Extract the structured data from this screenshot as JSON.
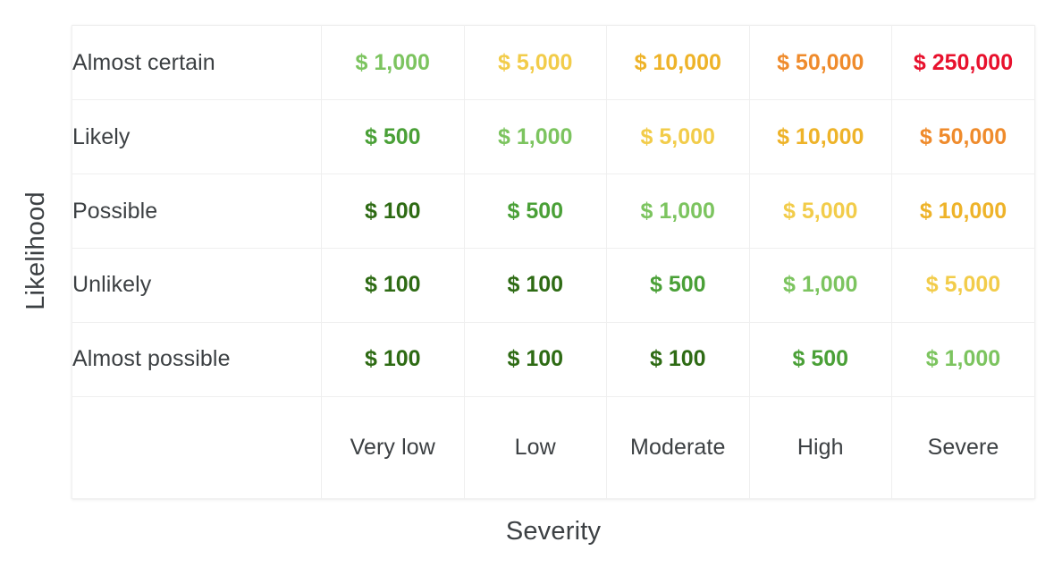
{
  "axes": {
    "y_label": "Likelihood",
    "x_label": "Severity"
  },
  "chart_data": {
    "type": "heatmap",
    "title": "",
    "xlabel": "Severity",
    "ylabel": "Likelihood",
    "x_categories": [
      "Very low",
      "Low",
      "Moderate",
      "High",
      "Severe"
    ],
    "y_categories": [
      "Almost certain",
      "Likely",
      "Possible",
      "Unlikely",
      "Almost possible"
    ],
    "legend": [],
    "grid": true,
    "cell_text_colors": {
      "$ 100": "#2e6b14",
      "$ 500": "#4aa037",
      "$ 1,000": "#7cc45f",
      "$ 5,000": "#f2cc4a",
      "$ 10,000": "#eeb329",
      "$ 50,000": "#ef8b2c",
      "$ 250,000": "#e8112d"
    },
    "rows": [
      {
        "label": "Almost certain",
        "cells": [
          {
            "text": "$ 1,000",
            "value": 1000,
            "color": "#7cc45f"
          },
          {
            "text": "$ 5,000",
            "value": 5000,
            "color": "#f2cc4a"
          },
          {
            "text": "$ 10,000",
            "value": 10000,
            "color": "#eeb329"
          },
          {
            "text": "$ 50,000",
            "value": 50000,
            "color": "#ef8b2c"
          },
          {
            "text": "$ 250,000",
            "value": 250000,
            "color": "#e8112d"
          }
        ]
      },
      {
        "label": "Likely",
        "cells": [
          {
            "text": "$ 500",
            "value": 500,
            "color": "#4aa037"
          },
          {
            "text": "$ 1,000",
            "value": 1000,
            "color": "#7cc45f"
          },
          {
            "text": "$ 5,000",
            "value": 5000,
            "color": "#f2cc4a"
          },
          {
            "text": "$ 10,000",
            "value": 10000,
            "color": "#eeb329"
          },
          {
            "text": "$ 50,000",
            "value": 50000,
            "color": "#ef8b2c"
          }
        ]
      },
      {
        "label": "Possible",
        "cells": [
          {
            "text": "$ 100",
            "value": 100,
            "color": "#2e6b14"
          },
          {
            "text": "$ 500",
            "value": 500,
            "color": "#4aa037"
          },
          {
            "text": "$ 1,000",
            "value": 1000,
            "color": "#7cc45f"
          },
          {
            "text": "$ 5,000",
            "value": 5000,
            "color": "#f2cc4a"
          },
          {
            "text": "$ 10,000",
            "value": 10000,
            "color": "#eeb329"
          }
        ]
      },
      {
        "label": "Unlikely",
        "cells": [
          {
            "text": "$ 100",
            "value": 100,
            "color": "#2e6b14"
          },
          {
            "text": "$ 100",
            "value": 100,
            "color": "#2e6b14"
          },
          {
            "text": "$ 500",
            "value": 500,
            "color": "#4aa037"
          },
          {
            "text": "$ 1,000",
            "value": 1000,
            "color": "#7cc45f"
          },
          {
            "text": "$ 5,000",
            "value": 5000,
            "color": "#f2cc4a"
          }
        ]
      },
      {
        "label": "Almost possible",
        "cells": [
          {
            "text": "$ 100",
            "value": 100,
            "color": "#2e6b14"
          },
          {
            "text": "$ 100",
            "value": 100,
            "color": "#2e6b14"
          },
          {
            "text": "$ 100",
            "value": 100,
            "color": "#2e6b14"
          },
          {
            "text": "$ 500",
            "value": 500,
            "color": "#4aa037"
          },
          {
            "text": "$ 1,000",
            "value": 1000,
            "color": "#7cc45f"
          }
        ]
      }
    ]
  }
}
